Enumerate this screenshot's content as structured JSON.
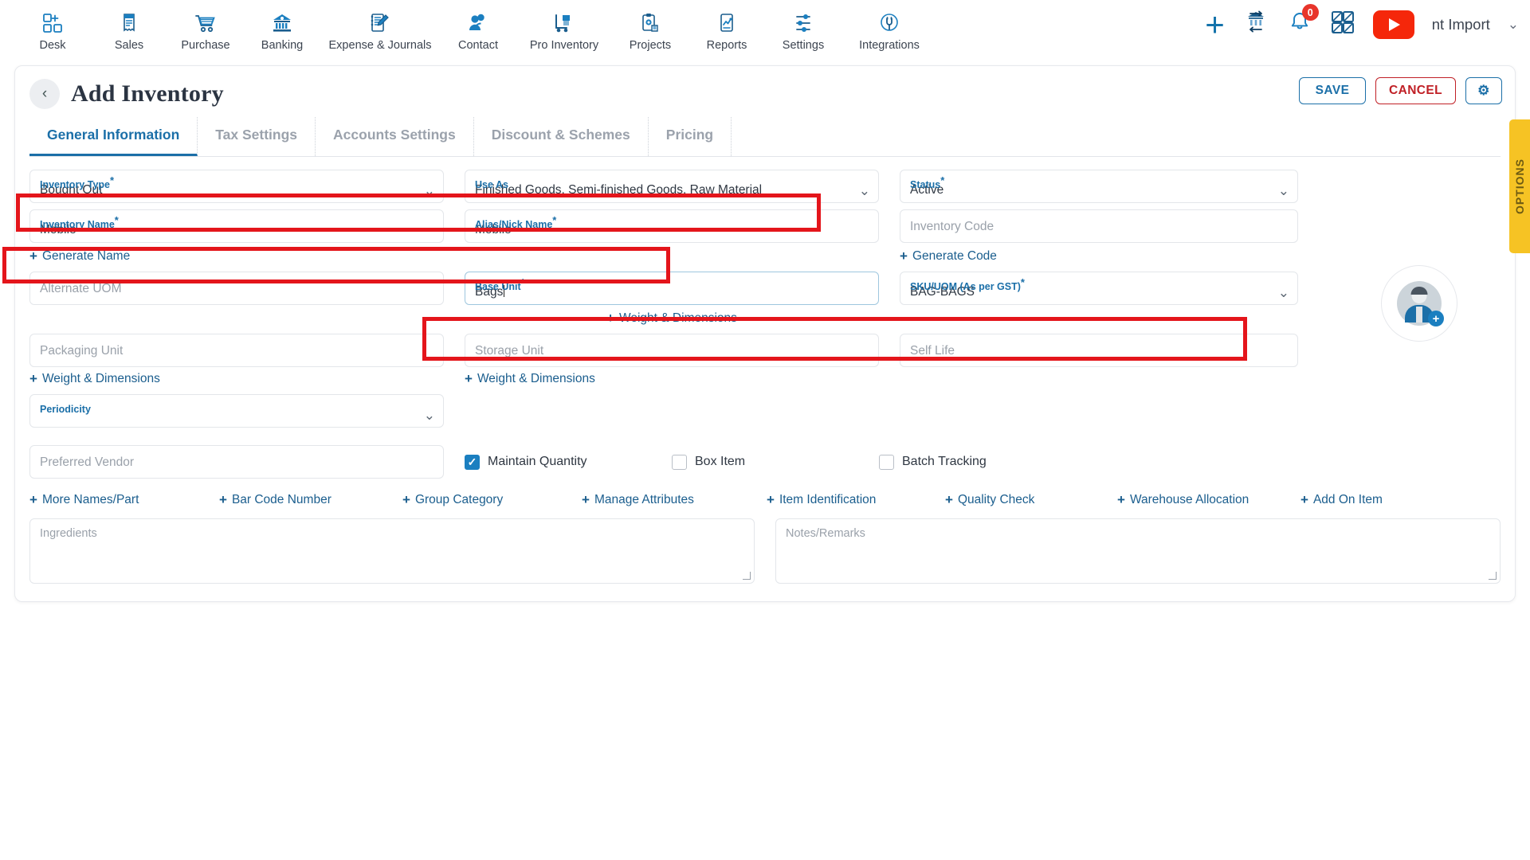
{
  "topnav": {
    "items": [
      {
        "label": "Desk",
        "icon": "desk-grid-plus-icon"
      },
      {
        "label": "Sales",
        "icon": "receipt-icon"
      },
      {
        "label": "Purchase",
        "icon": "shopping-cart-icon"
      },
      {
        "label": "Banking",
        "icon": "bank-building-icon"
      },
      {
        "label": "Expense & Journals",
        "icon": "notebook-pen-icon"
      },
      {
        "label": "Contact",
        "icon": "people-icon"
      },
      {
        "label": "Pro Inventory",
        "icon": "hand-truck-icon"
      },
      {
        "label": "Projects",
        "icon": "clipboard-icon"
      },
      {
        "label": "Reports",
        "icon": "report-chart-icon"
      },
      {
        "label": "Settings",
        "icon": "sliders-icon"
      },
      {
        "label": "Integrations",
        "icon": "plug-icon"
      }
    ],
    "add_icon": "plus-icon",
    "bank_transfer_icon": "bank-transfer-icon",
    "notification_icon": "bell-icon",
    "notification_count": "0",
    "apps_icon": "apps-grid-icon",
    "youtube_icon": "youtube-icon",
    "user_name": "nt Import",
    "user_caret_icon": "chevron-down-icon"
  },
  "header": {
    "back_icon": "chevron-left-icon",
    "title": "Add Inventory",
    "save_label": "SAVE",
    "cancel_label": "CANCEL",
    "gear_icon": "gear-icon"
  },
  "tabs": [
    {
      "label": "General Information",
      "active": true
    },
    {
      "label": "Tax Settings",
      "active": false
    },
    {
      "label": "Accounts Settings",
      "active": false
    },
    {
      "label": "Discount & Schemes",
      "active": false
    },
    {
      "label": "Pricing",
      "active": false
    }
  ],
  "form": {
    "inventory_type": {
      "label": "Inventory Type",
      "required": "*",
      "value": "Bought Out"
    },
    "use_as": {
      "label": "Use As",
      "required": "",
      "value": "Finished Goods, Semi-finished Goods, Raw Material"
    },
    "status": {
      "label": "Status",
      "required": "*",
      "value": "Active"
    },
    "inventory_name": {
      "label": "Inventory Name",
      "required": "*",
      "value": "Mobile"
    },
    "alias_nick_name": {
      "label": "Alias/Nick Name",
      "required": "*",
      "value": "Mobile"
    },
    "inventory_code": {
      "label": "",
      "required": "",
      "placeholder": "Inventory Code",
      "value": ""
    },
    "generate_name_label": "Generate Name",
    "generate_code_label": "Generate Code",
    "alternate_uom": {
      "placeholder": "Alternate UOM",
      "value": ""
    },
    "base_unit": {
      "label": "Base Unit",
      "required": "*",
      "value": "Bags"
    },
    "sku_uom": {
      "label": "SKU/UOM (As per GST)",
      "required": "*",
      "value": "BAG-BAGS"
    },
    "weight_dimensions_label": "Weight & Dimensions",
    "packaging_unit": {
      "placeholder": "Packaging Unit",
      "value": ""
    },
    "storage_unit": {
      "placeholder": "Storage Unit",
      "value": ""
    },
    "self_life": {
      "placeholder": "Self Life",
      "value": ""
    },
    "periodicity": {
      "label": "Periodicity",
      "required": "",
      "value": ""
    },
    "preferred_vendor": {
      "placeholder": "Preferred Vendor",
      "value": ""
    },
    "checkboxes": [
      {
        "label": "Maintain Quantity",
        "checked": true
      },
      {
        "label": "Box Item",
        "checked": false
      },
      {
        "label": "Batch Tracking",
        "checked": false
      }
    ],
    "bottom_links": [
      "More Names/Part",
      "Bar Code Number",
      "Group Category",
      "Manage Attributes",
      "Item Identification",
      "Quality Check",
      "Warehouse Allocation",
      "Add On Item"
    ],
    "ingredients": {
      "placeholder": "Ingredients",
      "value": ""
    },
    "notes_remarks": {
      "placeholder": "Notes/Remarks",
      "value": ""
    }
  },
  "avatar": {
    "icon": "user-add-avatar-icon"
  },
  "options_tab": {
    "label": "OPTIONS"
  },
  "colors": {
    "accent_blue": "#1b6fa8",
    "danger_red": "#c02026",
    "highlight_red": "#e4151b",
    "options_yellow": "#f6c324",
    "youtube_red": "#f5270a",
    "badge_red": "#e8352b"
  }
}
